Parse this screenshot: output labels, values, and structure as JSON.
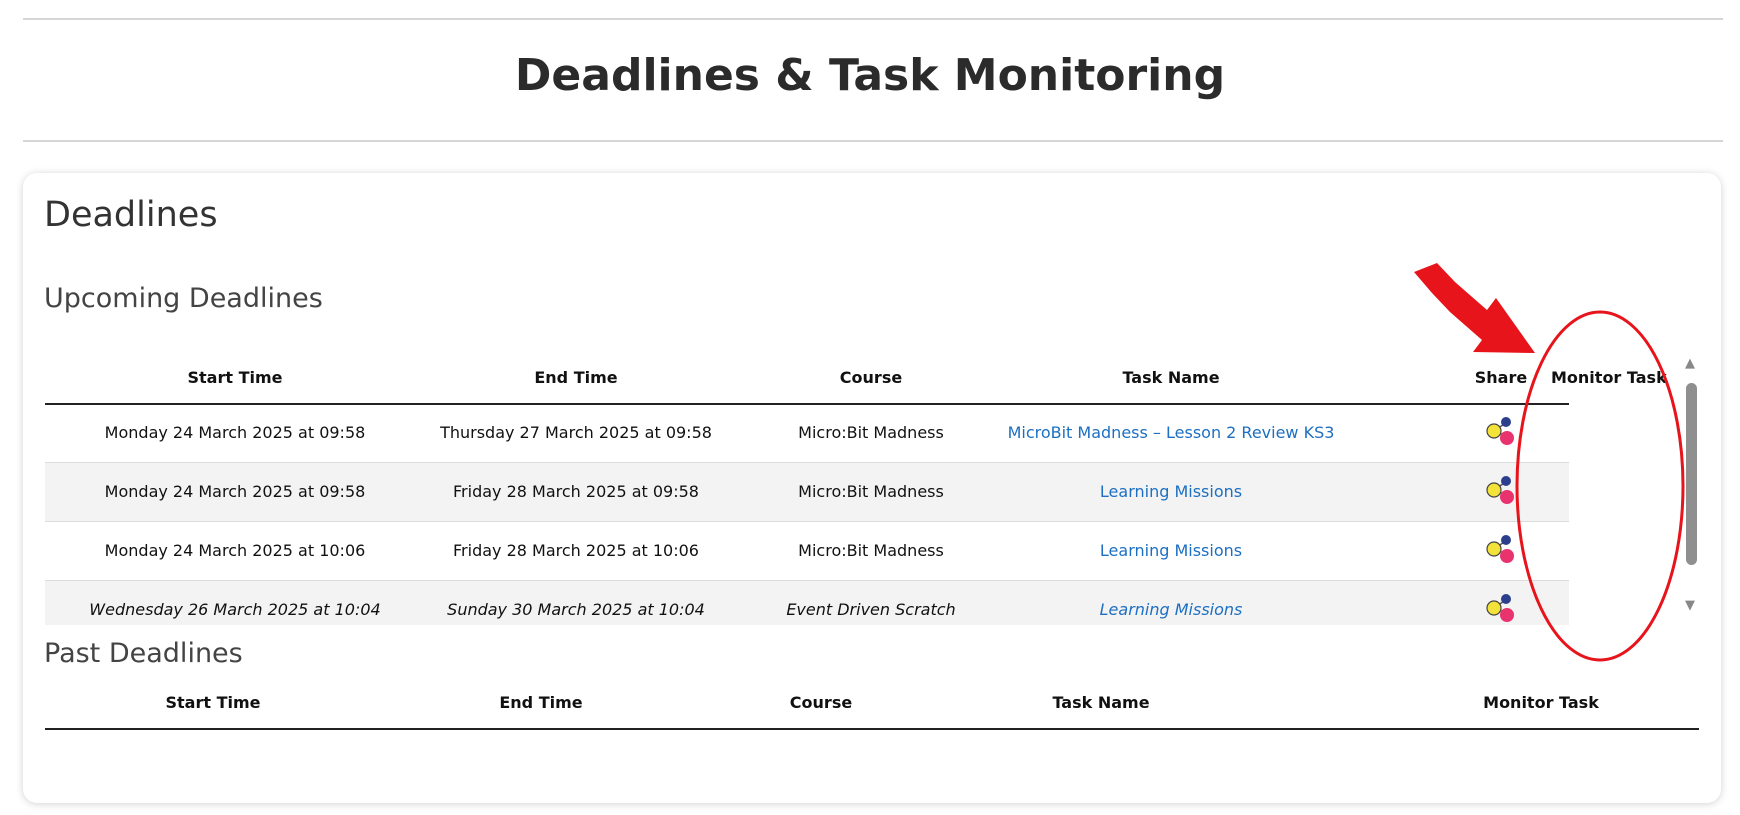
{
  "page": {
    "title": "Deadlines & Task Monitoring"
  },
  "card": {
    "heading": "Deadlines",
    "upcoming": {
      "heading": "Upcoming Deadlines",
      "columns": [
        "Start Time",
        "End Time",
        "Course",
        "Task Name",
        "Share",
        "Monitor Task"
      ],
      "rows": [
        {
          "start": "Monday 24 March 2025 at 09:58",
          "end": "Thursday 27 March 2025 at 09:58",
          "course": "Micro:Bit Madness",
          "task": "MicroBit Madness – Lesson 2 Review KS3"
        },
        {
          "start": "Monday 24 March 2025 at 09:58",
          "end": "Friday 28 March 2025 at 09:58",
          "course": "Micro:Bit Madness",
          "task": "Learning Missions"
        },
        {
          "start": "Monday 24 March 2025 at 10:06",
          "end": "Friday 28 March 2025 at 10:06",
          "course": "Micro:Bit Madness",
          "task": "Learning Missions"
        },
        {
          "start": "Wednesday 26 March 2025 at 10:04",
          "end": "Sunday 30 March 2025 at 10:04",
          "course": "Event Driven Scratch",
          "task": "Learning Missions"
        }
      ]
    },
    "past": {
      "heading": "Past Deadlines",
      "columns": [
        "Start Time",
        "End Time",
        "Course",
        "Task Name",
        "Monitor Task"
      ]
    }
  },
  "icons": {
    "share": "share-nodes-icon",
    "monitor": "monitor-task-magnifier-icon",
    "scroll_up": "triangle-up-icon",
    "scroll_down": "triangle-down-icon"
  },
  "colors": {
    "link": "#1c6fc2",
    "annotation": "#e8141b",
    "share_yellow": "#f3e23a",
    "share_pink": "#e8336f",
    "share_navy": "#2c3f8c"
  }
}
